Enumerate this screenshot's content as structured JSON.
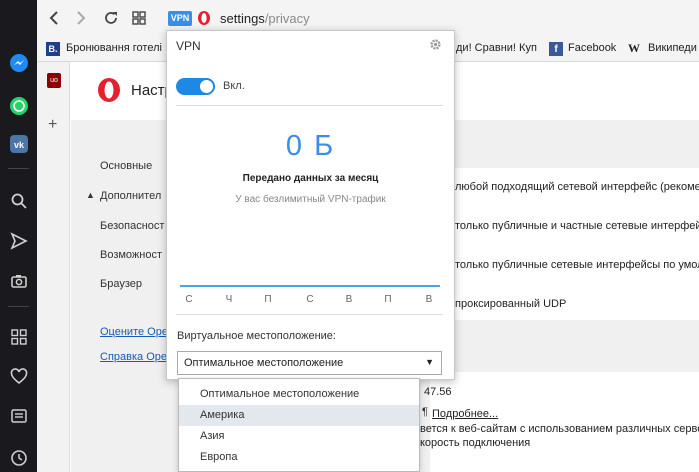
{
  "address": {
    "vpn_badge": "VPN",
    "host": "settings",
    "path": "/privacy"
  },
  "bookmarks": [
    {
      "label": "Бронювання готелі"
    },
    {
      "label": "ди! Сравни! Куп"
    },
    {
      "label": "Facebook"
    },
    {
      "label": "Википеди"
    }
  ],
  "settings": {
    "title": "Настр",
    "nav": [
      "Основные",
      "Дополнител",
      "Безопасност",
      "Возможност",
      "Браузер"
    ],
    "links": [
      "Оцените Opera",
      "Справка Opera"
    ],
    "webrtc_options": [
      "любой подходящий сетевой интерфейс (рекоме",
      "только публичные и частные сетевые интерфей",
      "только публичные сетевые интерфейсы по умол",
      "проксированный UDP"
    ],
    "version_fragment": "47.56",
    "more_link": "Подробнее...",
    "footer_line1": "вется к веб-сайтам с использованием различных сервер",
    "footer_line2": "корость подключения"
  },
  "vpn": {
    "title": "VPN",
    "toggle_label": "Вкл.",
    "toggle_on": true,
    "data_amount": "0 Б",
    "data_caption": "Передано данных за месяц",
    "unlimited": "У вас безлимитный VPN-трафик",
    "days": [
      "С",
      "Ч",
      "П",
      "С",
      "В",
      "П",
      "В"
    ],
    "location_label": "Виртуальное местоположение:",
    "location_value": "Оптимальное местоположение",
    "location_options": [
      "Оптимальное местоположение",
      "Америка",
      "Азия",
      "Европа"
    ],
    "highlighted_option": "Америка"
  },
  "colors": {
    "accent": "#1e88e5",
    "vpn_blue": "#3a8ee6",
    "opera_red": "#e5212d",
    "sidebar": "#1a1a1e"
  }
}
